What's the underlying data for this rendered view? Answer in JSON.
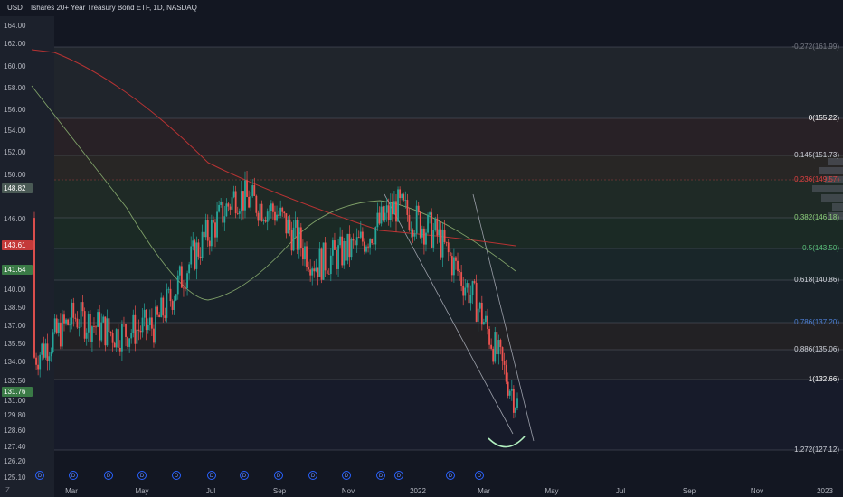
{
  "header": {
    "currency": "USD",
    "title": "Ishares 20+ Year Treasury Bond ETF, 1D, NASDAQ"
  },
  "y_axis": [
    "164.00",
    "162.00",
    "160.00",
    "158.00",
    "156.00",
    "154.00",
    "152.00",
    "150.00",
    "148.82",
    "146.00",
    "143.61",
    "141.64",
    "140.00",
    "138.50",
    "137.00",
    "135.50",
    "134.00",
    "132.50",
    "131.76",
    "131.00",
    "129.80",
    "128.60",
    "127.40",
    "126.20",
    "125.10"
  ],
  "price_tags": [
    {
      "label": "148.82",
      "color": "#4a5a55"
    },
    {
      "label": "143.61",
      "color": "#c43a3a"
    },
    {
      "label": "141.64",
      "color": "#3a7a46"
    },
    {
      "label": "131.76",
      "color": "#3a7a46"
    }
  ],
  "x_axis": [
    "Mar",
    "May",
    "Jul",
    "Sep",
    "Nov",
    "2022",
    "Mar",
    "May",
    "Jul",
    "Sep",
    "Nov",
    "2023"
  ],
  "dividend_badge": "D",
  "fib_levels": [
    {
      "label": "-0.272(161.99)",
      "color": "#787b86"
    },
    {
      "label": "0(155.22)",
      "color": "#ffffff"
    },
    {
      "label": "0.145(151.73)",
      "color": "#d1d4dc"
    },
    {
      "label": "0.236(149.57)",
      "color": "#e04040"
    },
    {
      "label": "0.382(146.18)",
      "color": "#8ccf7a"
    },
    {
      "label": "0.5(143.50)",
      "color": "#5bc27a"
    },
    {
      "label": "0.618(140.86)",
      "color": "#d1d4dc"
    },
    {
      "label": "0.786(137.20)",
      "color": "#4e7fd6"
    },
    {
      "label": "0.886(135.06)",
      "color": "#d1d4dc"
    },
    {
      "label": "1(132.66)",
      "color": "#ffffff"
    },
    {
      "label": "1.272(127.12)",
      "color": "#d1d4dc"
    }
  ],
  "chart_data": {
    "type": "candlestick",
    "title": "Ishares 20+ Year Treasury Bond ETF, 1D, NASDAQ",
    "x": [
      "2021-03",
      "2021-04",
      "2021-05",
      "2021-06",
      "2021-07",
      "2021-08",
      "2021-09",
      "2021-10",
      "2021-11",
      "2021-12",
      "2022-01",
      "2022-02",
      "2022-03"
    ],
    "series": [
      {
        "name": "Close",
        "values": [
          135.5,
          139.0,
          137.5,
          138.2,
          144.5,
          149.5,
          148.0,
          143.5,
          145.0,
          148.5,
          146.0,
          140.0,
          131.5
        ]
      }
    ],
    "ylim": [
      125.1,
      164.0
    ],
    "colors": {
      "up": "#26a69a",
      "down": "#ef5350",
      "ma_long": "#c23b3b",
      "ma_short": "#8fb07a"
    }
  }
}
